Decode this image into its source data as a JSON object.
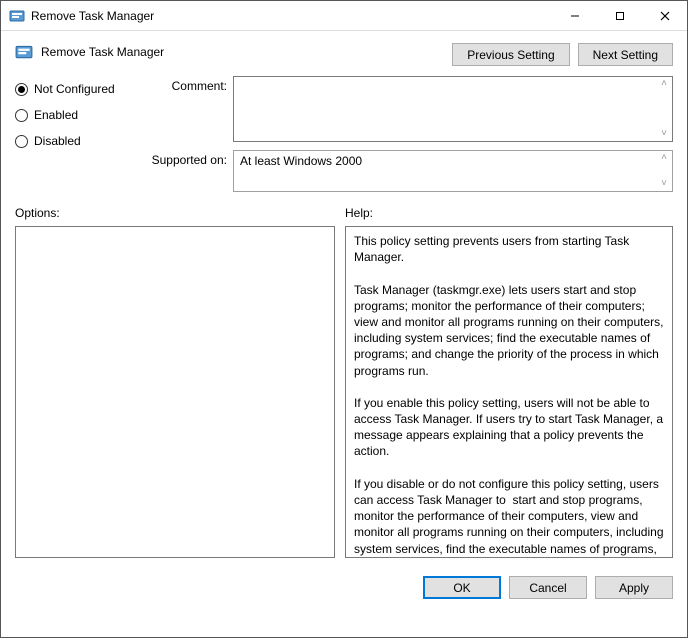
{
  "window": {
    "title": "Remove Task Manager"
  },
  "header": {
    "policy_name": "Remove Task Manager",
    "prev_label": "Previous Setting",
    "next_label": "Next Setting"
  },
  "state": {
    "options": [
      {
        "key": "not_configured",
        "label": "Not Configured",
        "checked": true
      },
      {
        "key": "enabled",
        "label": "Enabled",
        "checked": false
      },
      {
        "key": "disabled",
        "label": "Disabled",
        "checked": false
      }
    ]
  },
  "fields": {
    "comment_label": "Comment:",
    "comment_value": "",
    "supported_label": "Supported on:",
    "supported_value": "At least Windows 2000"
  },
  "sections": {
    "options_label": "Options:",
    "help_label": "Help:"
  },
  "options_panel": "",
  "help_text": "This policy setting prevents users from starting Task Manager.\n\nTask Manager (taskmgr.exe) lets users start and stop programs; monitor the performance of their computers; view and monitor all programs running on their computers, including system services; find the executable names of programs; and change the priority of the process in which programs run.\n\nIf you enable this policy setting, users will not be able to access Task Manager. If users try to start Task Manager, a message appears explaining that a policy prevents the action.\n\nIf you disable or do not configure this policy setting, users can access Task Manager to  start and stop programs, monitor the performance of their computers, view and monitor all programs running on their computers, including system services, find the executable names of programs, and change the priority of the process in which programs run.",
  "footer": {
    "ok": "OK",
    "cancel": "Cancel",
    "apply": "Apply"
  }
}
